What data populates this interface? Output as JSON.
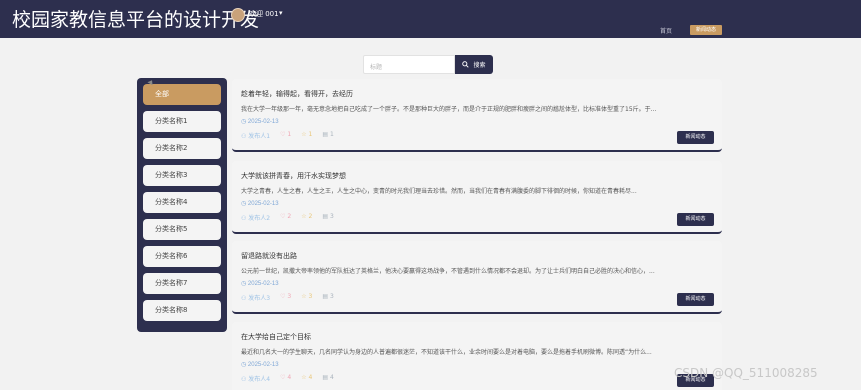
{
  "header": {
    "site_title": "校园家教信息平台的设计开发",
    "welcome": "欢迎 001",
    "nav_home": "首页",
    "nav_active": "新闻动态"
  },
  "search": {
    "placeholder": "标题",
    "button_label": "搜索"
  },
  "sidebar": {
    "items": [
      "全部",
      "分类名称1",
      "分类名称2",
      "分类名称3",
      "分类名称4",
      "分类名称5",
      "分类名称6",
      "分类名称7",
      "分类名称8"
    ],
    "active_index": 0
  },
  "cards": [
    {
      "title": "趁着年轻，输得起，看得开，去经历",
      "summary": "我在大学一年级那一年，毫无意念地把自己吃成了一个胖子。不是那种巨大的胖子，而是介于正规的肥胖和瘦胖之间的尴尬体型，比标准体型重了15斤。于...",
      "date": "2025-02-13",
      "author": "发布人1",
      "likes": "1",
      "favorites": "1",
      "comments": "1",
      "tag": "新闻动态"
    },
    {
      "title": "大学就该拼青春，用汗水实现梦想",
      "summary": "大学之青春，人生之春，人生之王，人生之中心，变青的时光我们理当去珍惜。然而，当我们在青春有满腹委的脚下徘徊的时候，你知道在青春耗尽...",
      "date": "2025-02-13",
      "author": "发布人2",
      "likes": "2",
      "favorites": "2",
      "comments": "3",
      "tag": "新闻动态"
    },
    {
      "title": "留退路就没有出路",
      "summary": "公元前一世纪，凯撒大帝率领他的军队抵达了英格兰，他决心要赢得这场战争，不管遇到什么情况都不会退却。为了让士兵们明白自己必胜的决心和信心，...",
      "date": "2025-02-13",
      "author": "发布人3",
      "likes": "3",
      "favorites": "3",
      "comments": "3",
      "tag": "新闻动态"
    },
    {
      "title": "在大学给自己定个目标",
      "summary": "最近和几名大一的学生聊天，几名同学认为身边的人普遍都很迷茫，不知道该干什么，业余时间要么是对着电脑，要么是拖着手机刷微博。陈同透“为什么...",
      "date": "2025-02-13",
      "author": "发布人4",
      "likes": "4",
      "favorites": "4",
      "comments": "4",
      "tag": "新闻动态"
    }
  ],
  "watermark": "CSDN @QQ_511008285",
  "colors": {
    "navy": "#2d2f4e",
    "accent_gold": "#c99b61",
    "card_bg": "#f4f4f4"
  }
}
